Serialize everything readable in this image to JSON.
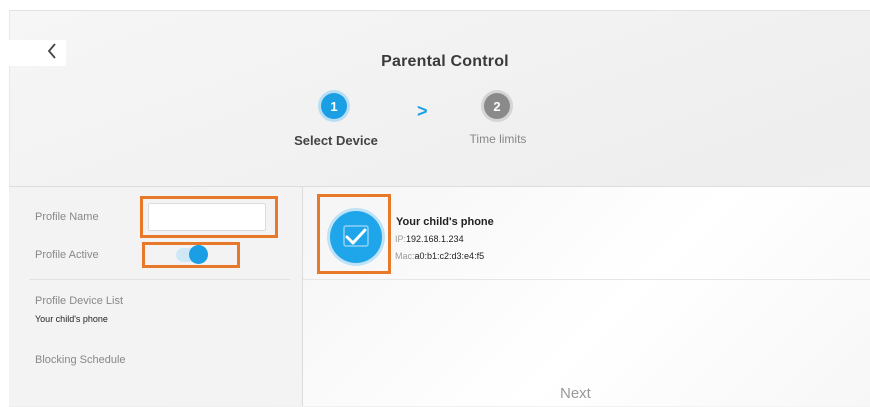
{
  "header": {
    "title": "Parental Control"
  },
  "steps": [
    {
      "number": "1",
      "label": "Select Device",
      "state": "active"
    },
    {
      "number": "2",
      "label": "Time limits",
      "state": "inactive"
    }
  ],
  "step_separator": ">",
  "profile": {
    "name_label": "Profile Name",
    "name_value": "",
    "active_label": "Profile Active",
    "active": true,
    "device_list_label": "Profile Device List",
    "device_list_value": "Your child's phone",
    "schedule_label": "Blocking Schedule"
  },
  "device": {
    "name": "Your child's phone",
    "ip_label": "IP:",
    "ip": "192.168.1.234",
    "mac_label": "Mac:",
    "mac": "a0:b1:c2:d3:e4:f5",
    "selected": true
  },
  "footer": {
    "next_label": "Next"
  },
  "colors": {
    "accent": "#1b9fe4",
    "highlight": "#e8792a",
    "inactive_step": "#8a8a8a"
  }
}
